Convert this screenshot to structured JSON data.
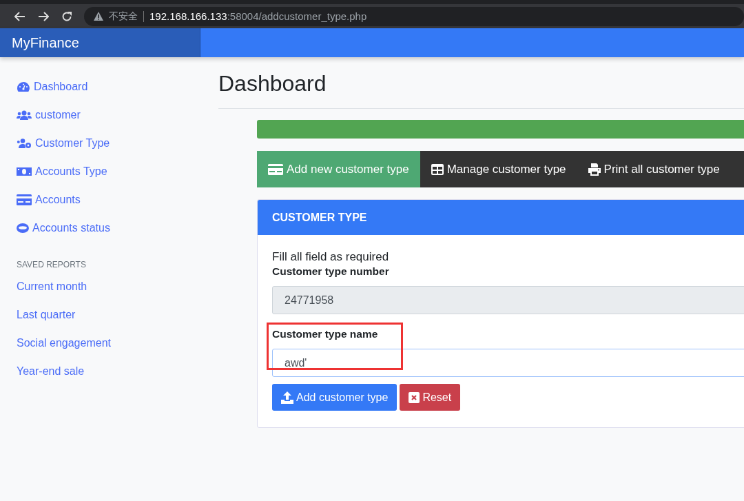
{
  "browser": {
    "security": "不安全",
    "host": "192.168.166.133",
    "path": ":58004/addcustomer_type.php"
  },
  "navbar": {
    "brand": "MyFinance"
  },
  "sidebar": {
    "items": [
      {
        "label": "Dashboard",
        "kind": "gauge"
      },
      {
        "label": "customer",
        "kind": "users"
      },
      {
        "label": "Customer Type",
        "kind": "users-cog"
      },
      {
        "label": "Accounts Type",
        "kind": "money"
      },
      {
        "label": "Accounts",
        "kind": "card"
      },
      {
        "label": "Accounts status",
        "kind": "ring"
      }
    ],
    "section_heading": "SAVED REPORTS",
    "reports": [
      {
        "label": "Current month"
      },
      {
        "label": "Last quarter"
      },
      {
        "label": "Social engagement"
      },
      {
        "label": "Year-end sale"
      }
    ]
  },
  "page_title": "Dashboard",
  "progress": {
    "level": 1
  },
  "tabs": [
    {
      "label": "Add new customer type",
      "kind": "card",
      "selected": true
    },
    {
      "label": "Manage customer type",
      "kind": "table",
      "selected": false
    },
    {
      "label": "Print all customer type",
      "kind": "print",
      "selected": false
    }
  ],
  "card": {
    "title": "CUSTOMER TYPE",
    "hint": "Fill all field as required",
    "fields": [
      {
        "label": "Customer type number",
        "value": "24771958",
        "disabled": true,
        "highlighted": false
      },
      {
        "label": "Customer type name",
        "value": "awd'",
        "disabled": false,
        "highlighted": true
      }
    ],
    "buttons": [
      {
        "label": "Add customer type",
        "kind": "primary"
      },
      {
        "label": "Reset",
        "kind": "danger"
      }
    ]
  }
}
